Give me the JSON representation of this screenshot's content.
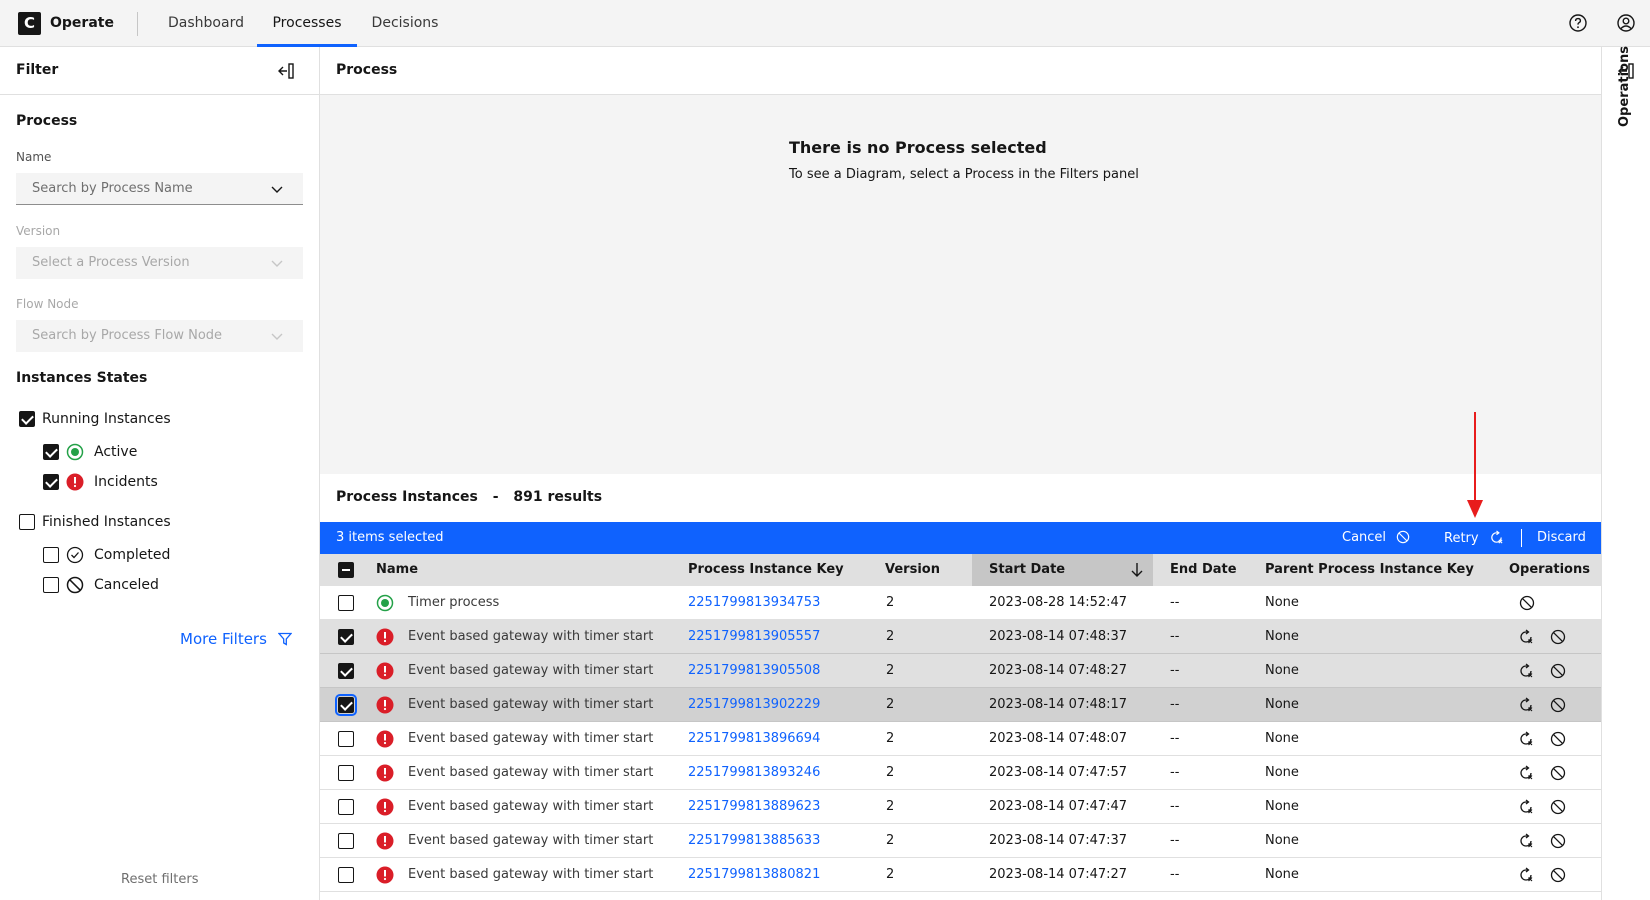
{
  "header": {
    "logo_letter": "C",
    "app_name": "Operate",
    "tabs": [
      {
        "label": "Dashboard",
        "active": false
      },
      {
        "label": "Processes",
        "active": true
      },
      {
        "label": "Decisions",
        "active": false
      }
    ],
    "icons": [
      "help-icon",
      "user-icon"
    ]
  },
  "filter": {
    "title": "Filter",
    "process_section": "Process",
    "name_label": "Name",
    "name_placeholder": "Search by Process Name",
    "version_label": "Version",
    "version_placeholder": "Select a Process Version",
    "flow_node_label": "Flow Node",
    "flow_node_placeholder": "Search by Process Flow Node",
    "states_title": "Instances States",
    "running": "Running Instances",
    "active": "Active",
    "incidents": "Incidents",
    "finished": "Finished Instances",
    "completed": "Completed",
    "canceled": "Canceled",
    "more_filters": "More Filters",
    "reset": "Reset filters"
  },
  "process_panel": {
    "title": "Process",
    "empty_title": "There is no Process selected",
    "empty_subtitle": "To see a Diagram, select a Process in the Filters panel"
  },
  "instances": {
    "title": "Process Instances",
    "separator": "-",
    "count": "891 results",
    "selected_text": "3 items selected",
    "cancel": "Cancel",
    "retry": "Retry",
    "discard": "Discard",
    "columns": [
      "Name",
      "Process Instance Key",
      "Version",
      "Start Date",
      "End Date",
      "Parent Process Instance Key",
      "Operations"
    ],
    "rows": [
      {
        "state": "active",
        "name": "Timer process",
        "key": "2251799813934753",
        "version": "2",
        "start": "2023-08-28 14:52:47",
        "end": "--",
        "parent": "None",
        "checked": false
      },
      {
        "state": "incident",
        "name": "Event based gateway with timer start",
        "key": "2251799813905557",
        "version": "2",
        "start": "2023-08-14 07:48:37",
        "end": "--",
        "parent": "None",
        "checked": true
      },
      {
        "state": "incident",
        "name": "Event based gateway with timer start",
        "key": "2251799813905508",
        "version": "2",
        "start": "2023-08-14 07:48:27",
        "end": "--",
        "parent": "None",
        "checked": true
      },
      {
        "state": "incident",
        "name": "Event based gateway with timer start",
        "key": "2251799813902229",
        "version": "2",
        "start": "2023-08-14 07:48:17",
        "end": "--",
        "parent": "None",
        "checked": true
      },
      {
        "state": "incident",
        "name": "Event based gateway with timer start",
        "key": "2251799813896694",
        "version": "2",
        "start": "2023-08-14 07:48:07",
        "end": "--",
        "parent": "None",
        "checked": false
      },
      {
        "state": "incident",
        "name": "Event based gateway with timer start",
        "key": "2251799813893246",
        "version": "2",
        "start": "2023-08-14 07:47:57",
        "end": "--",
        "parent": "None",
        "checked": false
      },
      {
        "state": "incident",
        "name": "Event based gateway with timer start",
        "key": "2251799813889623",
        "version": "2",
        "start": "2023-08-14 07:47:47",
        "end": "--",
        "parent": "None",
        "checked": false
      },
      {
        "state": "incident",
        "name": "Event based gateway with timer start",
        "key": "2251799813885633",
        "version": "2",
        "start": "2023-08-14 07:47:37",
        "end": "--",
        "parent": "None",
        "checked": false
      },
      {
        "state": "incident",
        "name": "Event based gateway with timer start",
        "key": "2251799813880821",
        "version": "2",
        "start": "2023-08-14 07:47:27",
        "end": "--",
        "parent": "None",
        "checked": false
      }
    ]
  },
  "operations_rail": {
    "label": "Operations"
  },
  "colors": {
    "accent": "#0f62fe",
    "incident": "#da1e28",
    "active": "#24a148",
    "annotation": "#e81c1c"
  }
}
